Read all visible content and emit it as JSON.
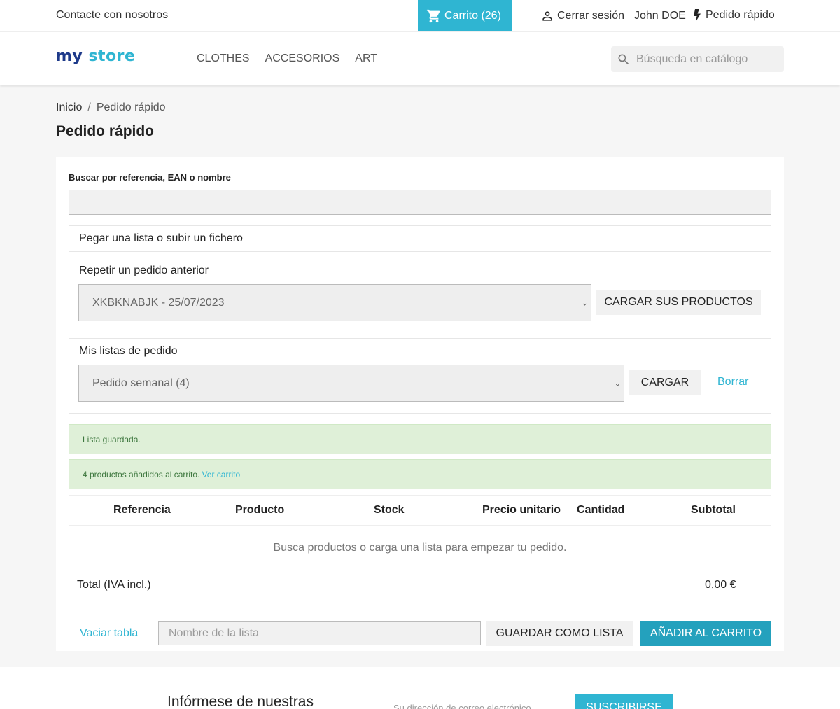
{
  "topbar": {
    "contact": "Contacte con nosotros",
    "cart": "Carrito (26)",
    "logout": "Cerrar sesión",
    "user": "John DOE",
    "quick_order": "Pedido rápido"
  },
  "header": {
    "logo_my": "my",
    "logo_store": "store",
    "nav": [
      "CLOTHES",
      "ACCESORIOS",
      "ART"
    ],
    "search_placeholder": "Búsqueda en catálogo"
  },
  "breadcrumb": {
    "home": "Inicio",
    "separator": "/",
    "current": "Pedido rápido"
  },
  "page_title": "Pedido rápido",
  "quick_order": {
    "search_label": "Buscar por referencia, EAN o nombre",
    "paste_title": "Pegar una lista o subir un fichero",
    "repeat": {
      "title": "Repetir un pedido anterior",
      "selected": "XKBKNABJK - 25/07/2023",
      "button": "CARGAR SUS PRODUCTOS"
    },
    "lists": {
      "title": "Mis listas de pedido",
      "selected": "Pedido semanal (4)",
      "load_button": "CARGAR",
      "delete_link": "Borrar"
    },
    "alerts": {
      "saved": "Lista guardada.",
      "added": "4 productos añadidos al carrito.",
      "view_cart": "Ver carrito"
    },
    "table": {
      "headers": [
        "Referencia",
        "Producto",
        "Stock",
        "Precio unitario",
        "Cantidad",
        "Subtotal"
      ],
      "empty": "Busca productos o carga una lista para empezar tu pedido.",
      "total_label": "Total (IVA incl.)",
      "total_value": "0,00 €"
    },
    "actions": {
      "clear": "Vaciar tabla",
      "list_name_placeholder": "Nombre de la lista",
      "save_list": "GUARDAR COMO LISTA",
      "add_to_cart": "AÑADIR AL CARRITO"
    }
  },
  "newsletter": {
    "title": "Infórmese de nuestras",
    "email_placeholder": "Su dirección de correo electrónico",
    "subscribe": "SUSCRIBIRSE"
  },
  "colors": {
    "accent": "#2fb5d2",
    "accent_dark": "#24a1bd",
    "success_bg": "#dff0d8",
    "success_text": "#3c763d"
  }
}
